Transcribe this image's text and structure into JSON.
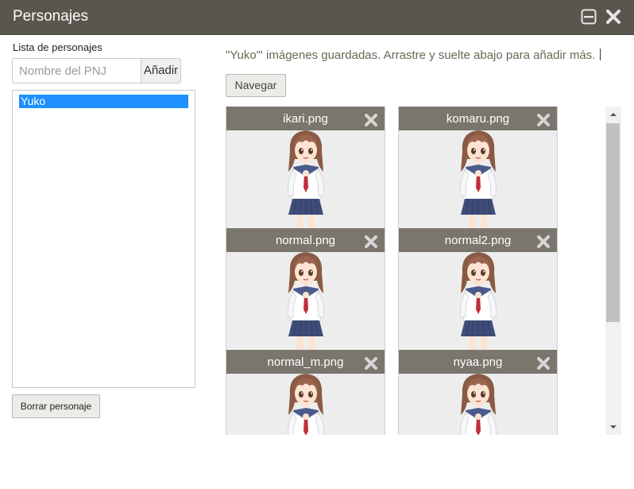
{
  "window": {
    "title": "Personajes",
    "minimize_icon": "minimize-icon",
    "close_icon": "close-icon"
  },
  "sidebar": {
    "list_label": "Lista de personajes",
    "input": {
      "placeholder": "Nombre del PNJ",
      "value": ""
    },
    "add_label": "Añadir",
    "characters": [
      {
        "name": "Yuko",
        "selected": true
      }
    ],
    "selected_color": "#1e90ff",
    "delete_label": "Borrar personaje"
  },
  "main": {
    "info_text": "\"Yuko\"' imágenes guardadas. Arrastre y suelte abajo para añadir más.",
    "browse_label": "Navegar",
    "images": [
      {
        "name": "ikari.png",
        "remove_icon": "close-icon"
      },
      {
        "name": "komaru.png",
        "remove_icon": "close-icon"
      },
      {
        "name": "normal.png",
        "remove_icon": "close-icon"
      },
      {
        "name": "normal2.png",
        "remove_icon": "close-icon"
      },
      {
        "name": "normal_m.png",
        "remove_icon": "close-icon"
      },
      {
        "name": "nyaa.png",
        "remove_icon": "close-icon"
      }
    ]
  },
  "colors": {
    "titlebar": "#5a564e",
    "card_header": "#7a766d",
    "info_text": "#6c6657"
  }
}
